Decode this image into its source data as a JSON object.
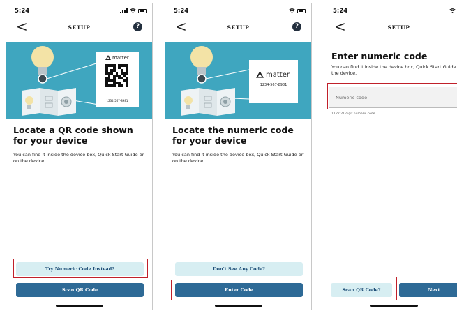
{
  "status": {
    "time": "5:24"
  },
  "header": {
    "title": "SETUP",
    "help_glyph": "?",
    "back_glyph": "<"
  },
  "accent_color": "#3fa6bf",
  "highlight_color": "#c0202a",
  "matter": {
    "brand": "matter",
    "setup_code": "1234-567-8981"
  },
  "screens": [
    {
      "heading": "Locate a QR code shown for your device",
      "description": "You can find it inside the device box, Quick Start Guide or on the device.",
      "buttons": {
        "secondary": "Try Numeric Code Instead?",
        "primary": "Scan QR Code"
      }
    },
    {
      "heading": "Locate the numeric code for your device",
      "description": "You can find it inside the device box, Quick Start Guide or on the device.",
      "buttons": {
        "secondary": "Don't See Any Code?",
        "primary": "Enter Code"
      }
    },
    {
      "heading": "Enter numeric code",
      "description": "You can find it inside the device box, Quick Start Guide or on the device.",
      "field": {
        "placeholder": "Numeric code",
        "hint": "11 or 21 digit numeric code"
      },
      "buttons": {
        "secondary": "Scan QR Code?",
        "primary": "Next"
      }
    }
  ]
}
